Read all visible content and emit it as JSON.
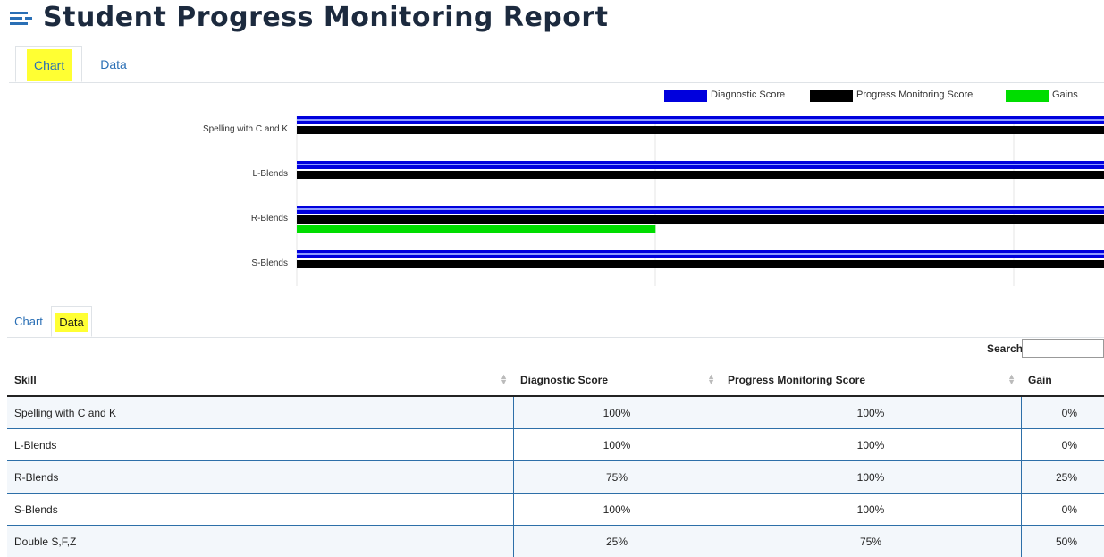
{
  "header": {
    "title": "Student Progress Monitoring Report",
    "icon": "report-list-icon"
  },
  "top_tabs": [
    {
      "label": "Chart",
      "active": true
    },
    {
      "label": "Data",
      "active": false
    }
  ],
  "bottom_tabs": [
    {
      "label": "Chart",
      "active": false
    },
    {
      "label": "Data",
      "active": true
    }
  ],
  "colors": {
    "diagnostic": "#0000dd",
    "progress": "#000000",
    "gains": "#00dd00",
    "highlight": "#ffff33",
    "link": "#2a6fb5"
  },
  "chart_data": {
    "type": "bar",
    "orientation": "horizontal",
    "categories": [
      "Spelling with C and K",
      "L-Blends",
      "R-Blends",
      "S-Blends"
    ],
    "series": [
      {
        "name": "Diagnostic Score",
        "values": [
          100,
          100,
          75,
          100
        ]
      },
      {
        "name": "Progress Monitoring Score",
        "values": [
          100,
          100,
          100,
          100
        ]
      },
      {
        "name": "Gains",
        "values": [
          0,
          0,
          25,
          0
        ]
      }
    ],
    "xlim": [
      0,
      56.25
    ],
    "grid": true,
    "legend": "top-right"
  },
  "search": {
    "label": "Search:",
    "value": ""
  },
  "table": {
    "columns": [
      "Skill",
      "Diagnostic Score",
      "Progress Monitoring Score",
      "Gain"
    ],
    "rows": [
      [
        "Spelling with C and K",
        "100%",
        "100%",
        "0%"
      ],
      [
        "L-Blends",
        "100%",
        "100%",
        "0%"
      ],
      [
        "R-Blends",
        "75%",
        "100%",
        "25%"
      ],
      [
        "S-Blends",
        "100%",
        "100%",
        "0%"
      ],
      [
        "Double S,F,Z",
        "25%",
        "75%",
        "50%"
      ]
    ]
  }
}
